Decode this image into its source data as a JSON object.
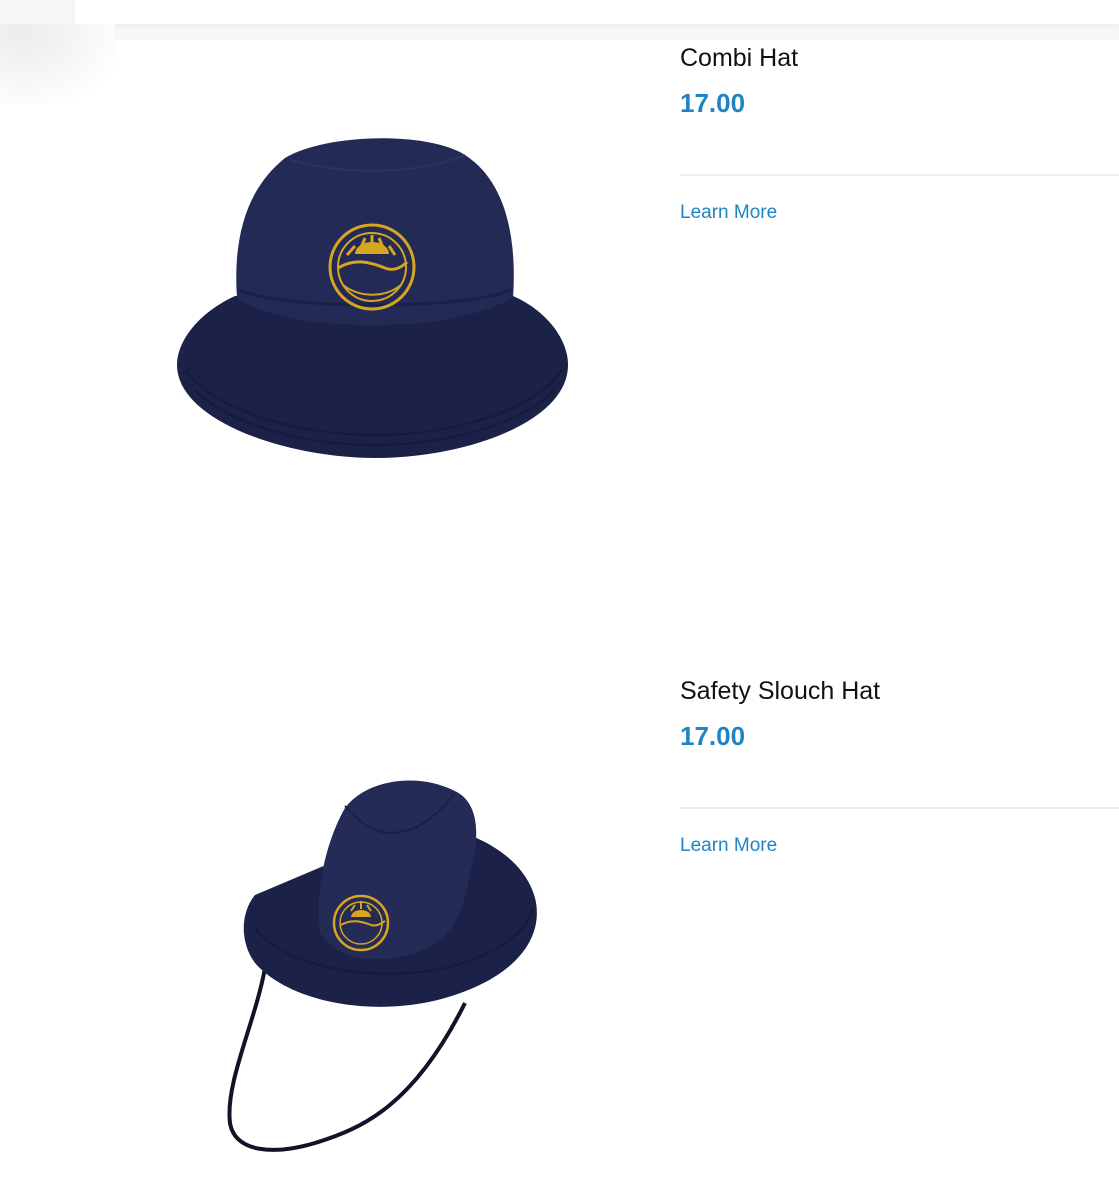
{
  "colors": {
    "accent": "#1f84c4",
    "hat_navy": "#1f2650",
    "logo_gold": "#d8a51f"
  },
  "products": [
    {
      "name": "Combi Hat",
      "price": "17.00",
      "link_label": "Learn More",
      "image_icon": "combi-hat-image"
    },
    {
      "name": "Safety Slouch Hat",
      "price": "17.00",
      "link_label": "Learn More",
      "image_icon": "safety-slouch-hat-image"
    }
  ]
}
